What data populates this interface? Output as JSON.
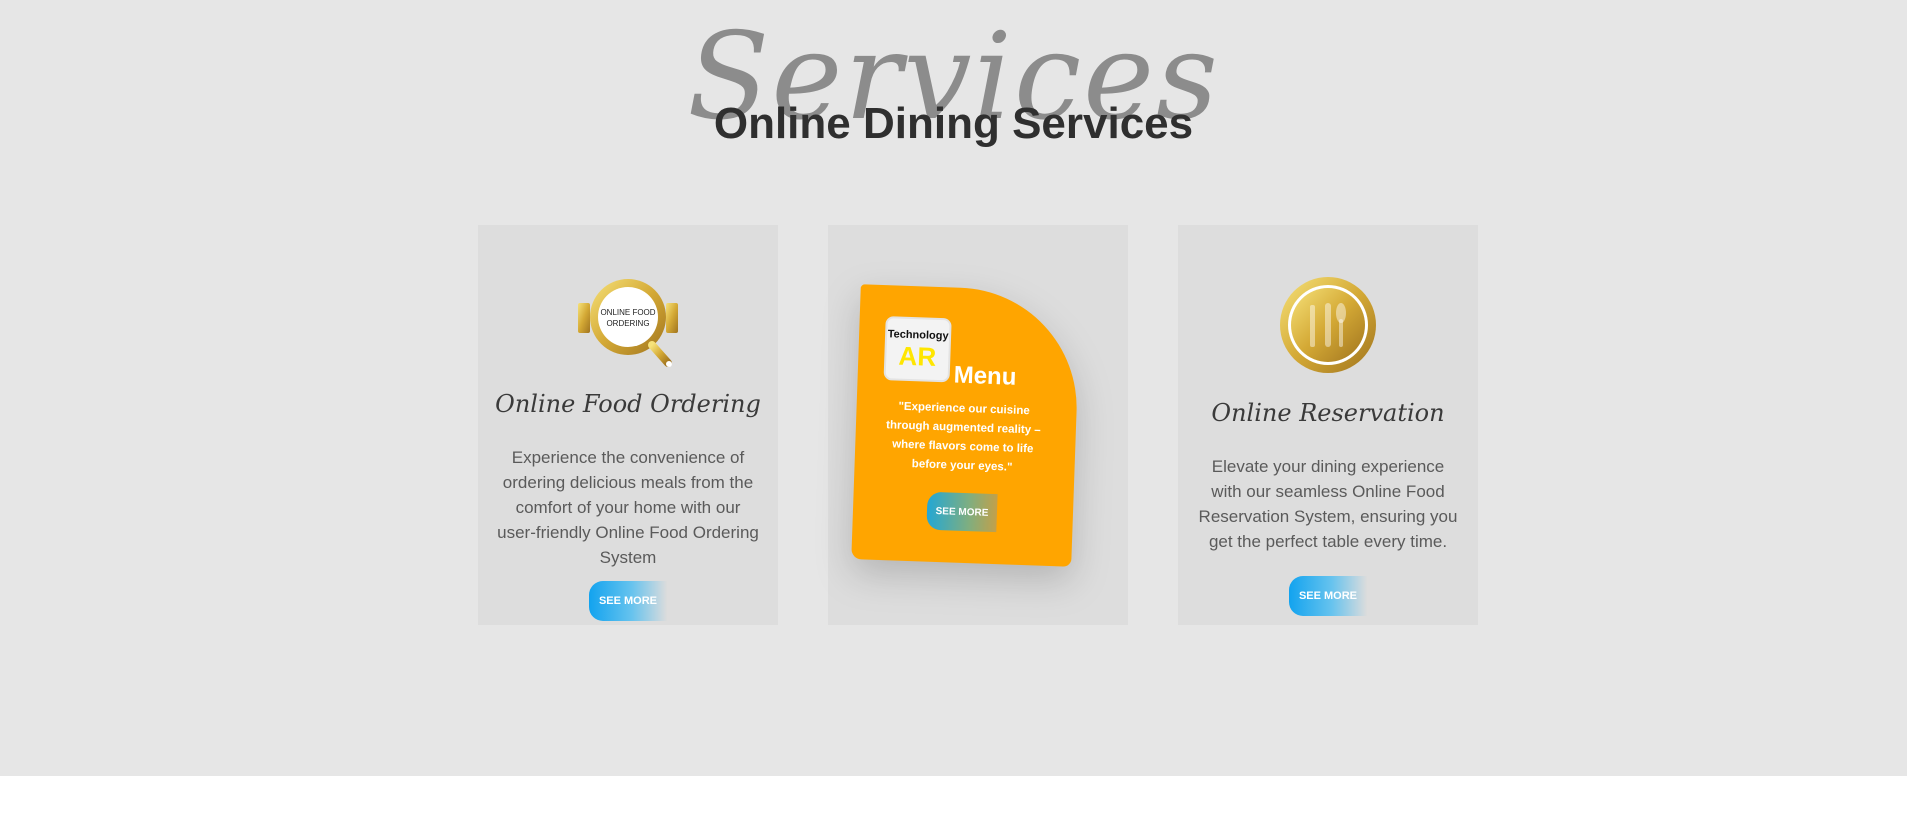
{
  "section": {
    "bg_script": "Services",
    "title": "Online Dining Services"
  },
  "cards": [
    {
      "logo_text_line1": "ONLINE FOOD",
      "logo_text_line2": "ORDERING",
      "title": "Online Food Ordering",
      "description": "Experience the convenience of ordering delicious meals from the comfort of your home with our user-friendly Online Food Ordering System",
      "button": "SEE MORE"
    },
    {
      "badge_top": "Technology",
      "badge_big": "AR",
      "menu_word": "Menu",
      "quote": "\"Experience our cuisine through augmented reality – where flavors come to life before your eyes.\"",
      "button": "SEE MORE"
    },
    {
      "title": "Online Reservation",
      "description": "Elevate your dining experience with our seamless Online Food Reservation System, ensuring you get the perfect table every time.",
      "button": "SEE MORE"
    }
  ],
  "colors": {
    "section_bg": "#e6e6e6",
    "card_bg": "#dddddd",
    "ar_orange": "#ffa500",
    "gold": "#d4a935",
    "button_blue": "#12a3ef"
  },
  "icons": {
    "card1": "frying-pan-logo-icon",
    "card3": "fork-spoon-knife-icon"
  }
}
